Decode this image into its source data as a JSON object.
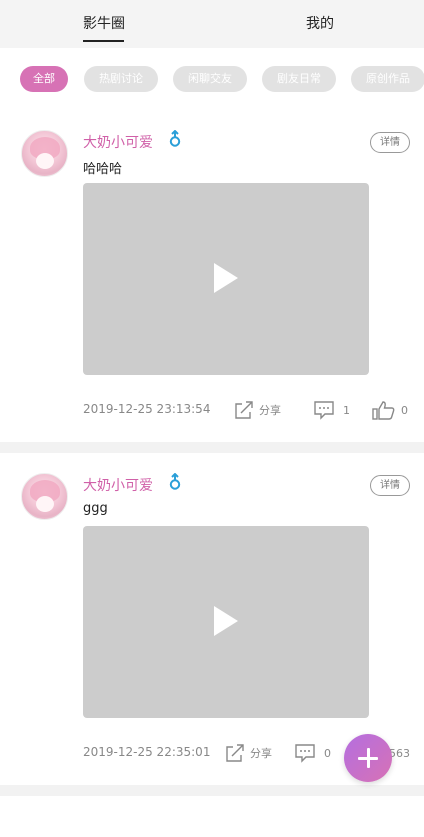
{
  "tabs": [
    {
      "label": "影牛圈",
      "active": true
    },
    {
      "label": "我的",
      "active": false
    }
  ],
  "chips": [
    {
      "label": "全部",
      "active": true
    },
    {
      "label": "热剧讨论",
      "active": false
    },
    {
      "label": "闲聊交友",
      "active": false
    },
    {
      "label": "剧友日常",
      "active": false
    },
    {
      "label": "原创作品",
      "active": false
    }
  ],
  "posts": [
    {
      "username": "大奶小可爱",
      "text": "哈哈哈",
      "detail_label": "详情",
      "date": "2019-12-25 23:13:54",
      "share_label": "分享",
      "comments": "1",
      "likes": "0"
    },
    {
      "username": "大奶小可爱",
      "text": "ggg",
      "detail_label": "详情",
      "date": "2019-12-25 22:35:01",
      "share_label": "分享",
      "comments": "0",
      "likes": "563"
    }
  ],
  "colors": {
    "accent": "#d772b5",
    "username": "#d060a8",
    "video_placeholder": "#cccccc"
  },
  "icons": {
    "gender": "male-gender-icon",
    "share": "share-icon",
    "comment": "comment-icon",
    "like": "thumbs-up-icon",
    "play": "play-icon",
    "fab": "plus-icon"
  }
}
